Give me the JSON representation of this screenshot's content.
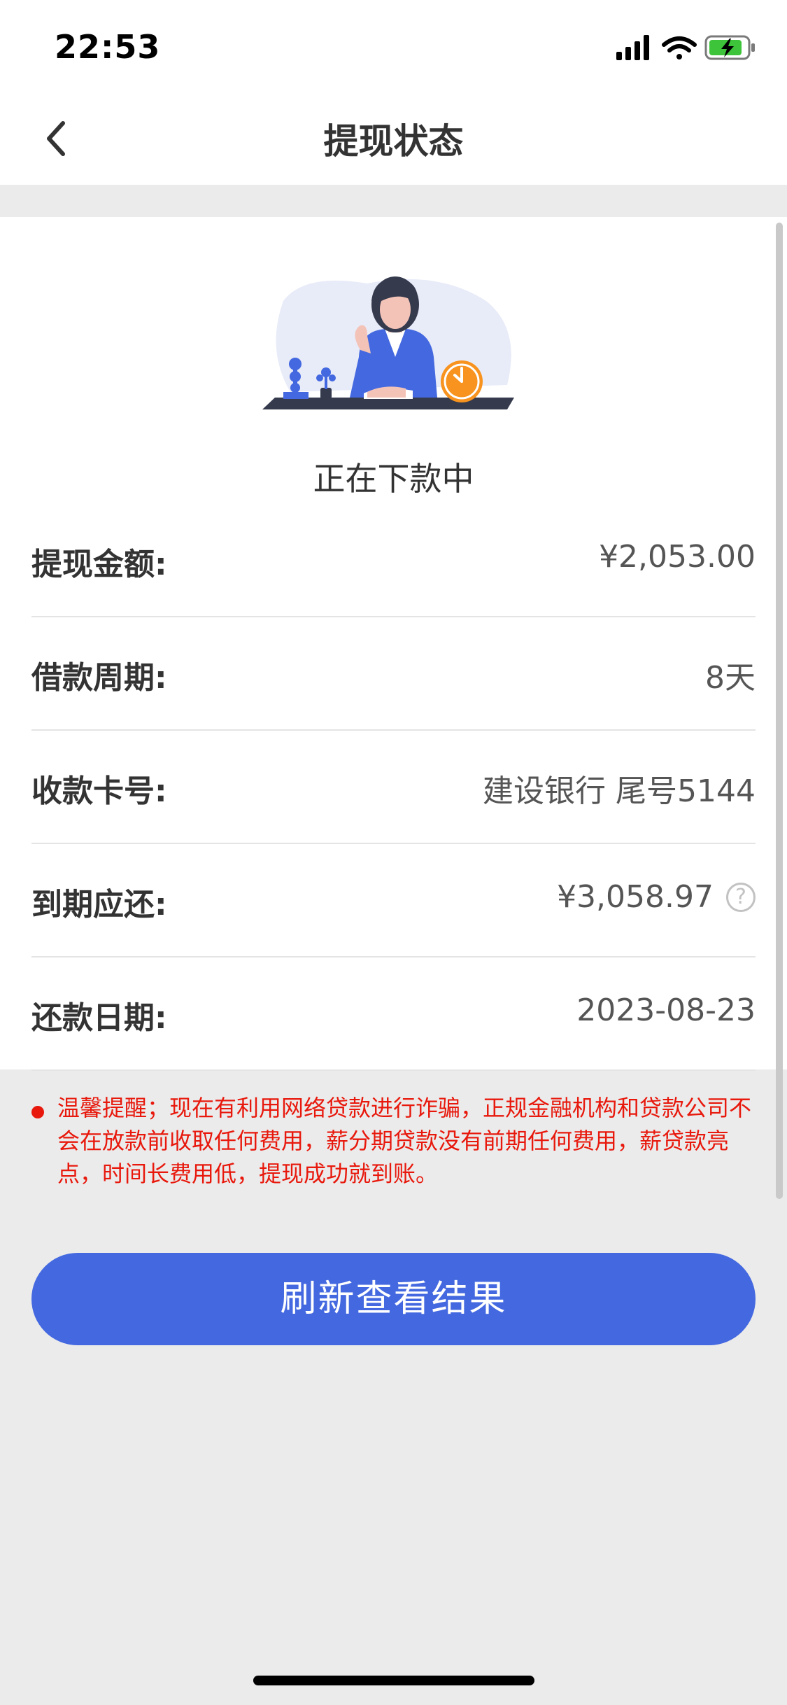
{
  "status_bar": {
    "time": "22:53"
  },
  "nav": {
    "title": "提现状态",
    "back_icon": "chevron-left-icon"
  },
  "status": {
    "text": "正在下款中",
    "illustration": "woman-waiting-clock-illustration"
  },
  "details": [
    {
      "label": "提现金额:",
      "value": "¥2,053.00"
    },
    {
      "label": "借款周期:",
      "value": "8天"
    },
    {
      "label": "收款卡号:",
      "value": "建设银行 尾号5144"
    },
    {
      "label": "到期应还:",
      "value": "¥3,058.97",
      "help_icon": "?"
    },
    {
      "label": "还款日期:",
      "value": "2023-08-23"
    }
  ],
  "notice": {
    "text": "温馨提醒；现在有利用网络贷款进行诈骗，正规金融机构和贷款公司不会在放款前收取任何费用，薪分期贷款没有前期任何费用，薪贷款亮点，时间长费用低，提现成功就到账。"
  },
  "actions": {
    "refresh_label": "刷新查看结果"
  },
  "colors": {
    "primary": "#4368e0",
    "warning": "#e8180c",
    "accent": "#f7931e"
  }
}
